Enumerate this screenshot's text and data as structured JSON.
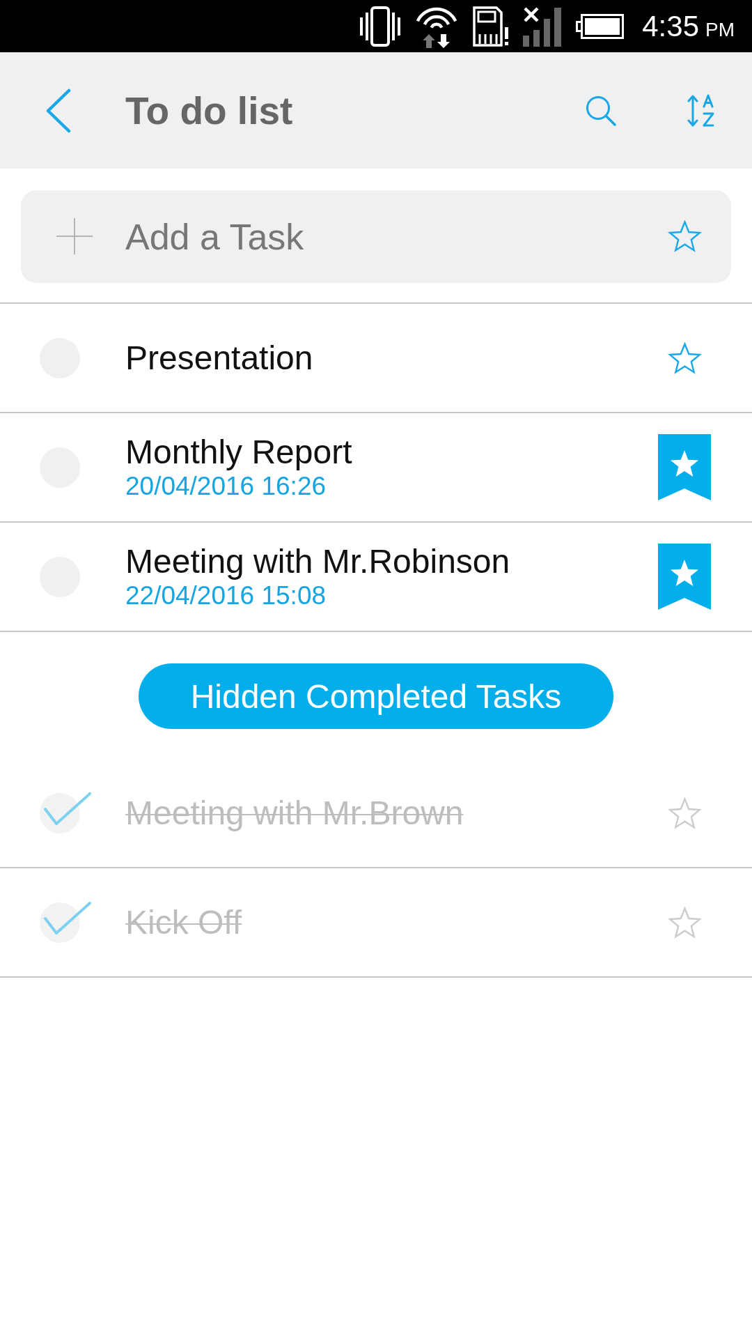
{
  "status_bar": {
    "time": "4:35",
    "period": "PM"
  },
  "header": {
    "title": "To do list"
  },
  "add_task": {
    "placeholder": "Add a Task"
  },
  "tasks": [
    {
      "title": "Presentation",
      "checked": false,
      "starred": false
    },
    {
      "title": "Monthly Report",
      "due": "20/04/2016 16:26",
      "checked": false,
      "starred": true
    },
    {
      "title": "Meeting with Mr.Robinson",
      "due": "22/04/2016 15:08",
      "checked": false,
      "starred": true
    }
  ],
  "completed_toggle": {
    "label": "Hidden Completed Tasks"
  },
  "completed_tasks": [
    {
      "title": "Meeting with Mr.Brown",
      "checked": true,
      "starred": false
    },
    {
      "title": "Kick Off",
      "checked": true,
      "starred": false
    }
  ]
}
